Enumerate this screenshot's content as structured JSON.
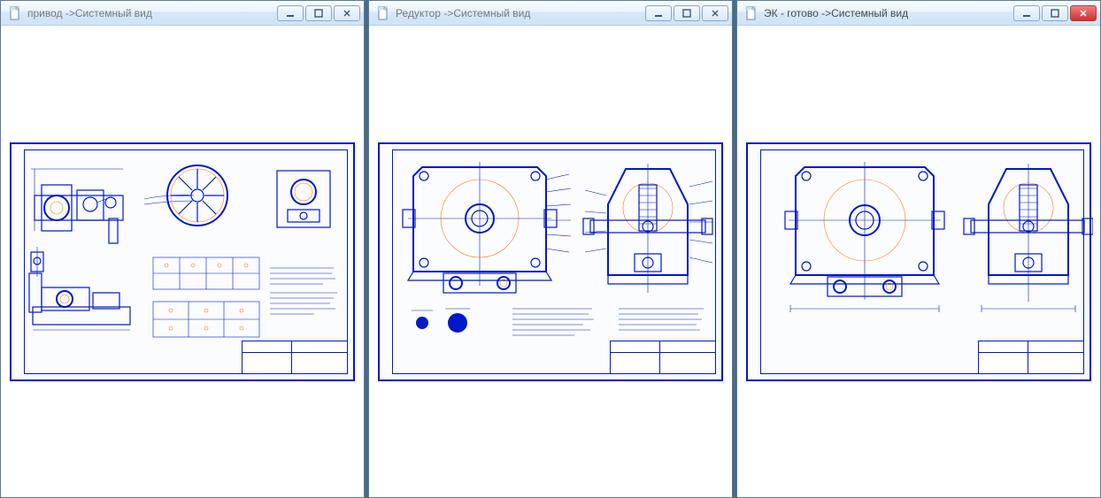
{
  "windows": [
    {
      "id": "w1",
      "title": "привод ->Системный вид",
      "active": false,
      "close_style": "normal"
    },
    {
      "id": "w2",
      "title": "Редуктор ->Системный вид",
      "active": false,
      "close_style": "normal"
    },
    {
      "id": "w3",
      "title": "ЭК - готово ->Системный вид",
      "active": true,
      "close_style": "active"
    }
  ],
  "icons": {
    "doc": "document-icon",
    "min": "minimize-icon",
    "max": "maximize-icon",
    "close": "close-icon"
  },
  "colors": {
    "line_primary": "#0018c8",
    "line_accent": "#ff7a00",
    "titlebar_text": "#4a4a4a",
    "close_active_bg": "#d03030"
  },
  "drawings": {
    "w1": {
      "label": "привод",
      "type": "assembly-drawing"
    },
    "w2": {
      "label": "Редуктор",
      "type": "assembly-drawing"
    },
    "w3": {
      "label": "ЭК - готово",
      "type": "assembly-drawing"
    }
  }
}
